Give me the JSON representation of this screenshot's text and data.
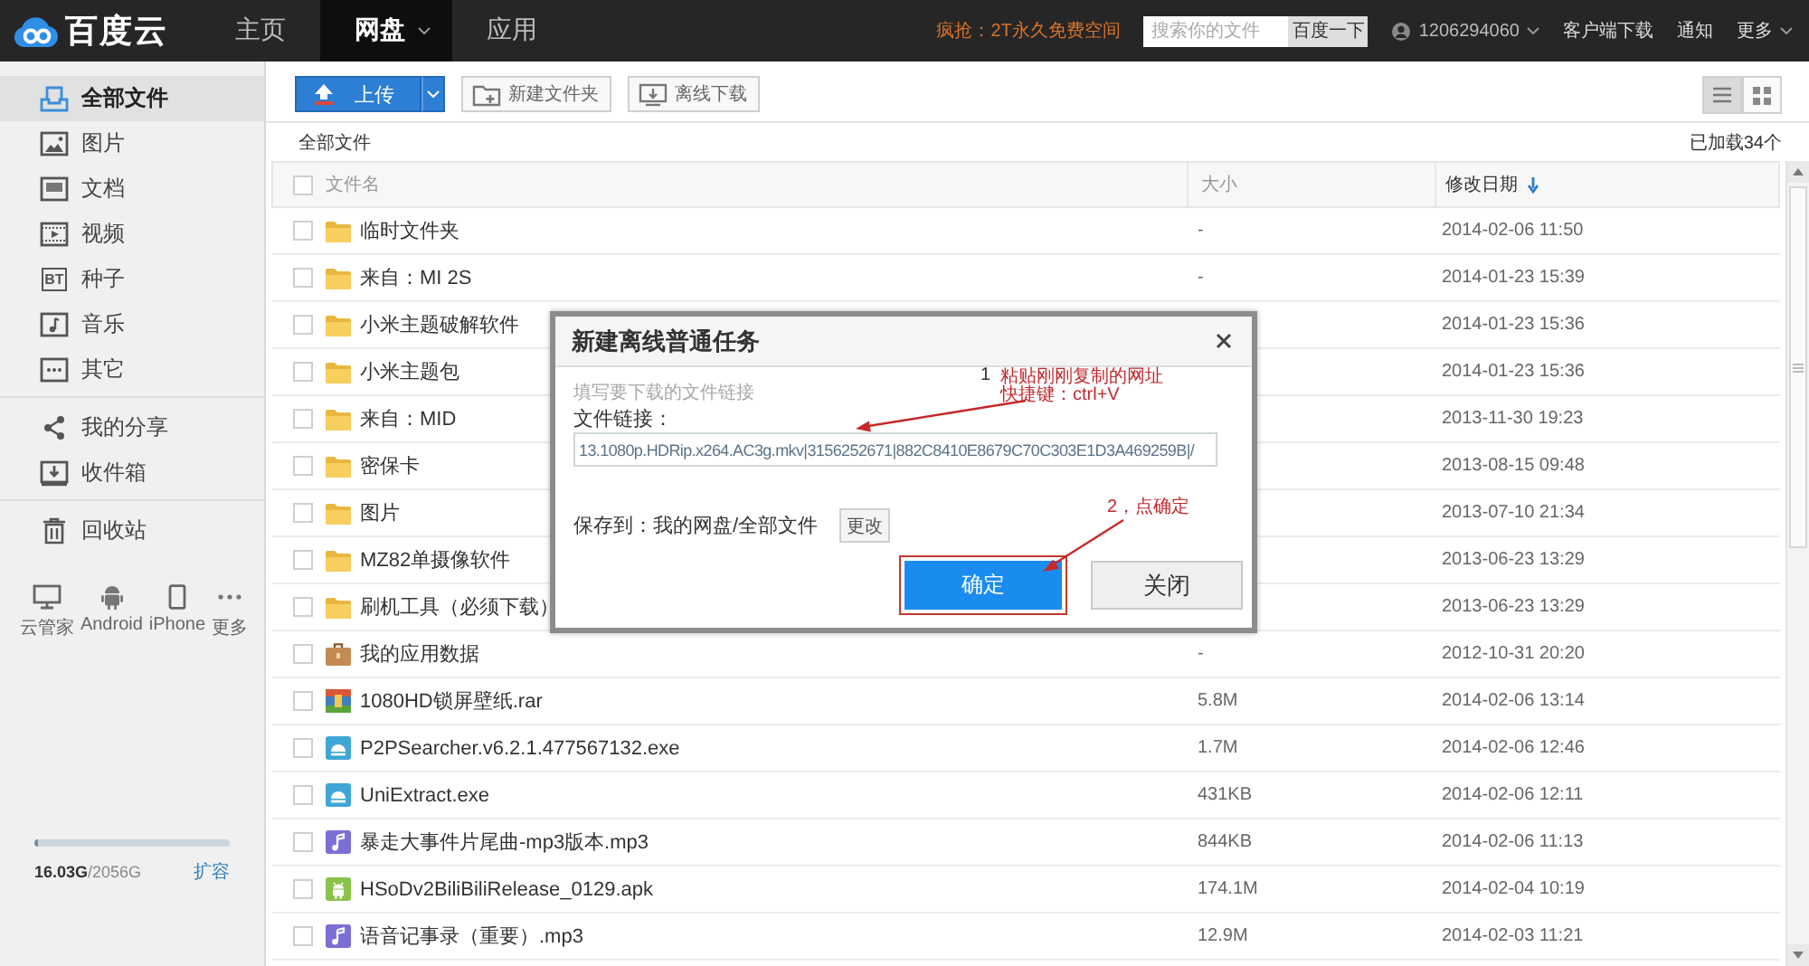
{
  "top_bar": {
    "logo": "百度云",
    "nav": [
      {
        "label": "主页",
        "selected": false,
        "dropdown": false
      },
      {
        "label": "网盘",
        "selected": true,
        "dropdown": true
      },
      {
        "label": "应用",
        "selected": false,
        "dropdown": false
      }
    ],
    "promo": "疯抢：2T永久免费空间",
    "search": {
      "placeholder": "搜索你的文件",
      "button": "百度一下"
    },
    "account": "1206294060",
    "links": [
      {
        "label": "客户端下载",
        "dropdown": false
      },
      {
        "label": "通知",
        "dropdown": false
      },
      {
        "label": "更多",
        "dropdown": true
      }
    ]
  },
  "sidebar": {
    "sections": [
      {
        "items": [
          {
            "kind": "all",
            "label": "全部文件",
            "selected": true
          },
          {
            "kind": "image",
            "label": "图片",
            "selected": false
          },
          {
            "kind": "document",
            "label": "文档",
            "selected": false
          },
          {
            "kind": "video",
            "label": "视频",
            "selected": false
          },
          {
            "kind": "torrent",
            "label": "种子",
            "icon_text": "BT",
            "selected": false
          },
          {
            "kind": "music",
            "label": "音乐",
            "selected": false
          },
          {
            "kind": "other",
            "label": "其它",
            "selected": false
          }
        ]
      },
      {
        "items": [
          {
            "kind": "share",
            "label": "我的分享",
            "selected": false
          },
          {
            "kind": "inbox",
            "label": "收件箱",
            "selected": false
          }
        ]
      },
      {
        "items": [
          {
            "kind": "trash",
            "label": "回收站",
            "selected": false
          }
        ]
      }
    ],
    "devices": [
      {
        "kind": "desktop",
        "label": "云管家"
      },
      {
        "kind": "android",
        "label": "Android"
      },
      {
        "kind": "phone",
        "label": "iPhone"
      },
      {
        "kind": "more",
        "label": "更多"
      }
    ],
    "quota": {
      "level": 0.02,
      "text": "**16.03G**/2056G",
      "link": "扩容"
    }
  },
  "toolbar": {
    "buttons": [
      {
        "kind": "upload",
        "label": "上传"
      },
      {
        "kind": "new_folder",
        "label": "新建文件夹"
      },
      {
        "kind": "offline",
        "label": "离线下载"
      }
    ],
    "views": [
      {
        "kind": "list",
        "selected": true
      },
      {
        "kind": "grid",
        "selected": false
      }
    ]
  },
  "breadcrumb": "全部文件",
  "loaded_count": "已加载34个",
  "table": {
    "header_checked": false,
    "columns": [
      {
        "label": "文件名",
        "sorted": false
      },
      {
        "label": "大小",
        "sorted": false
      },
      {
        "label": "修改日期",
        "sorted": true
      }
    ],
    "rows": [
      {
        "kind": "folder",
        "name": "临时文件夹",
        "size": "-",
        "date": "2014-02-06 11:50",
        "checked": false
      },
      {
        "kind": "folder",
        "name": "来自：MI 2S",
        "size": "-",
        "date": "2014-01-23 15:39",
        "checked": false
      },
      {
        "kind": "folder",
        "name": "小米主题破解软件",
        "date": "2014-01-23 15:36",
        "checked": false
      },
      {
        "kind": "folder",
        "name": "小米主题包",
        "date": "2014-01-23 15:36",
        "checked": false
      },
      {
        "kind": "folder",
        "name": "来自：MID",
        "date": "2013-11-30 19:23",
        "checked": false
      },
      {
        "kind": "folder",
        "name": "密保卡",
        "date": "2013-08-15 09:48",
        "checked": false
      },
      {
        "kind": "folder",
        "name": "图片",
        "date": "2013-07-10 21:34",
        "checked": false
      },
      {
        "kind": "folder",
        "name": "MZ82单摄像软件",
        "date": "2013-06-23 13:29",
        "checked": false
      },
      {
        "kind": "folder",
        "name": "刷机工具（必须下载）",
        "date": "2013-06-23 13:29",
        "checked": false
      },
      {
        "kind": "app_data",
        "name": "我的应用数据",
        "size": "-",
        "date": "2012-10-31 20:20",
        "checked": false
      },
      {
        "kind": "archive",
        "name": "1080HD锁屏壁纸.rar",
        "size": "5.8M",
        "date": "2014-02-06 13:14",
        "checked": false
      },
      {
        "kind": "program",
        "name": "P2PSearcher.v6.2.1.477567132.exe",
        "size": "1.7M",
        "date": "2014-02-06 12:46",
        "checked": false
      },
      {
        "kind": "program",
        "name": "UniExtract.exe",
        "size": "431KB",
        "date": "2014-02-06 12:11",
        "checked": false
      },
      {
        "kind": "audio",
        "name": "暴走大事件片尾曲-mp3版本.mp3",
        "size": "844KB",
        "date": "2014-02-06 11:13",
        "checked": false
      },
      {
        "kind": "apk",
        "name": "HSoDv2BiliBiliRelease_0129.apk",
        "size": "174.1M",
        "date": "2014-02-04 10:19",
        "checked": false
      },
      {
        "kind": "audio",
        "name": "语音记事录（重要）.mp3",
        "size": "12.9M",
        "date": "2014-02-03 11:21",
        "checked": false
      }
    ]
  },
  "dialog": {
    "title": "新建离线普通任务",
    "hint": "填写要下载的文件链接",
    "link_label": "文件链接：",
    "link_value": "13.1080p.HDRip.x264.AC3g.mkv|3156252671|882C8410E8679C70C303E1D3A469259B|/",
    "save_to": "保存到：我的网盘/全部文件",
    "change_button": "更改",
    "buttons": [
      {
        "kind": "primary",
        "label": "确定",
        "highlighted": true
      },
      {
        "kind": "secondary",
        "label": "关闭",
        "highlighted": false
      }
    ]
  },
  "annotations": [
    {
      "number": "1",
      "lines": [
        "粘贴刚刚复制的网址",
        "快捷键：ctrl+V"
      ]
    },
    {
      "text": "2，点确定"
    }
  ]
}
